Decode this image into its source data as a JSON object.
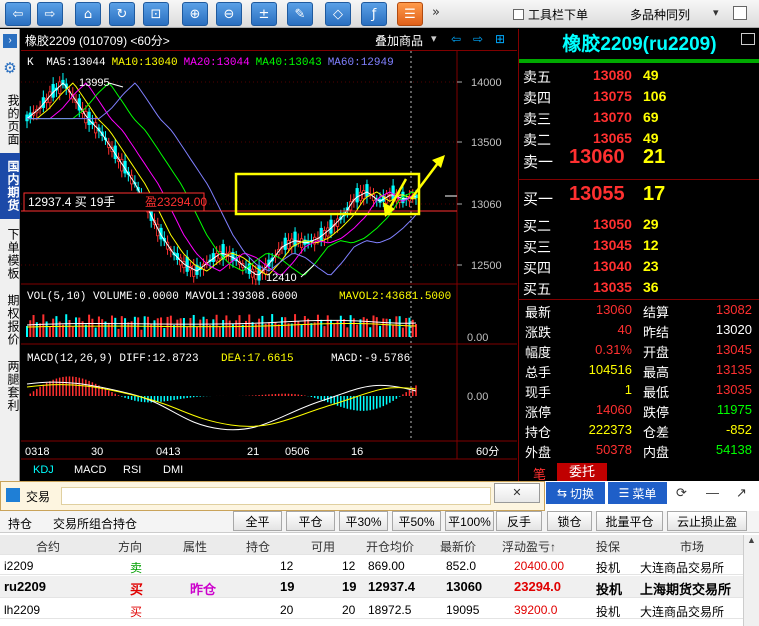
{
  "toolbar": {
    "buttons": [
      {
        "name": "back",
        "glyph": "⇦"
      },
      {
        "name": "forward",
        "glyph": "⇨"
      },
      {
        "name": "home",
        "glyph": "⌂"
      },
      {
        "name": "refresh",
        "glyph": "↻"
      },
      {
        "name": "crop",
        "glyph": "⊡"
      },
      {
        "name": "zoom-in",
        "glyph": "⊕"
      },
      {
        "name": "zoom-out",
        "glyph": "⊖"
      },
      {
        "name": "formula",
        "glyph": "±"
      },
      {
        "name": "draw",
        "glyph": "✎"
      },
      {
        "name": "tag",
        "glyph": "◇"
      },
      {
        "name": "function",
        "glyph": "ƒ"
      },
      {
        "name": "list",
        "glyph": "☰"
      }
    ],
    "more": "»",
    "checkbox_label": "工具栏下单",
    "select_value": "多品种同列"
  },
  "sidebar": {
    "items": [
      "我的页面",
      "国内期货",
      "下单模板",
      "期权报价",
      "两腿套利"
    ]
  },
  "chart": {
    "title": "橡胶2209 (010709) <60分>",
    "overlay_btn": "叠加商品",
    "ma_label": "K",
    "ma": [
      {
        "text": "MA5:13044",
        "color": "#ffffff"
      },
      {
        "text": "MA10:13040",
        "color": "#ffff00"
      },
      {
        "text": "MA20:13044",
        "color": "#ff00ff"
      },
      {
        "text": "MA40:13043",
        "color": "#00ff00"
      },
      {
        "text": "MA60:12949",
        "color": "#8080ff"
      }
    ],
    "high_label": "13995",
    "low_label": "12410",
    "position_label": "12937.4 买 19手",
    "position_profit": "盈23294.00",
    "price_ticks": [
      "14000",
      "13500",
      "13060",
      "12500"
    ],
    "vol_header": "VOL(5,10) VOLUME:0.0000 MAVOL1:39308.6000",
    "vol_mavol2": "MAVOL2:43681.5000",
    "vol_tick": "0.00",
    "macd_header": "MACD(12,26,9) DIFF:12.8723",
    "macd_dea": "DEA:17.6615",
    "macd_val": "MACD:-9.5786",
    "macd_tick": "0.00",
    "date_ticks": [
      "0318",
      "30",
      "0413",
      "21",
      "0506",
      "16"
    ],
    "period": "60分",
    "tabs": [
      "KDJ",
      "MACD",
      "RSI",
      "DMI"
    ]
  },
  "quote": {
    "title": "橡胶2209(ru2209)",
    "asks": [
      {
        "label": "卖五",
        "price": "13080",
        "vol": "49"
      },
      {
        "label": "卖四",
        "price": "13075",
        "vol": "106"
      },
      {
        "label": "卖三",
        "price": "13070",
        "vol": "69"
      },
      {
        "label": "卖二",
        "price": "13065",
        "vol": "49"
      }
    ],
    "ask1": {
      "label": "卖一",
      "price": "13060",
      "vol": "21"
    },
    "bid1": {
      "label": "买一",
      "price": "13055",
      "vol": "17"
    },
    "bids": [
      {
        "label": "买二",
        "price": "13050",
        "vol": "29"
      },
      {
        "label": "买三",
        "price": "13045",
        "vol": "12"
      },
      {
        "label": "买四",
        "price": "13040",
        "vol": "23"
      },
      {
        "label": "买五",
        "price": "13035",
        "vol": "36"
      }
    ],
    "stats": [
      {
        "l": "最新",
        "v": "13060",
        "vc": "#ff3030",
        "l2": "结算",
        "v2": "13082",
        "v2c": "#ff3030"
      },
      {
        "l": "涨跌",
        "v": "40",
        "vc": "#ff3030",
        "l2": "昨结",
        "v2": "13020",
        "v2c": "#ffffff"
      },
      {
        "l": "幅度",
        "v": "0.31%",
        "vc": "#ff3030",
        "l2": "开盘",
        "v2": "13045",
        "v2c": "#ff3030"
      },
      {
        "l": "总手",
        "v": "104516",
        "vc": "#ffff00",
        "l2": "最高",
        "v2": "13135",
        "v2c": "#ff3030"
      },
      {
        "l": "现手",
        "v": "1",
        "vc": "#ffff00",
        "l2": "最低",
        "v2": "13035",
        "v2c": "#ff3030"
      },
      {
        "l": "涨停",
        "v": "14060",
        "vc": "#ff3030",
        "l2": "跌停",
        "v2": "11975",
        "v2c": "#00ff00"
      },
      {
        "l": "持仓",
        "v": "222373",
        "vc": "#ffff00",
        "l2": "仓差",
        "v2": "-852",
        "v2c": "#ffff00"
      },
      {
        "l": "外盘",
        "v": "50378",
        "vc": "#ff3030",
        "l2": "内盘",
        "v2": "54138",
        "v2c": "#00ff00"
      }
    ],
    "tab_a": "笔",
    "tab_b": "委托"
  },
  "deal": {
    "title": "交易",
    "close": "✕",
    "switch": "切换",
    "menu": "菜单",
    "extra_icons": [
      "⟳",
      "—",
      "↗"
    ],
    "left_tabs": [
      "持仓",
      "交易所组合持仓"
    ],
    "actions": [
      "全平",
      "平仓",
      "平30%",
      "平50%",
      "平100%",
      "反手",
      "锁仓",
      "批量平仓",
      "云止损止盈"
    ],
    "columns": [
      "合约",
      "方向",
      "属性",
      "持仓",
      "可用",
      "开仓均价",
      "最新价",
      "浮动盈亏↑",
      "投保",
      "市场"
    ],
    "rows": [
      [
        "i2209",
        "卖",
        "",
        "12",
        "12",
        "869.00",
        "852.0",
        "20400.00",
        "投机",
        "大连商品交易所"
      ],
      [
        "ru2209",
        "买",
        "昨仓",
        "19",
        "19",
        "12937.4",
        "13060",
        "23294.0",
        "投机",
        "上海期货交易所"
      ],
      [
        "lh2209",
        "买",
        "",
        "20",
        "20",
        "18972.5",
        "19095",
        "39200.0",
        "投机",
        "大连商品交易所"
      ]
    ]
  }
}
